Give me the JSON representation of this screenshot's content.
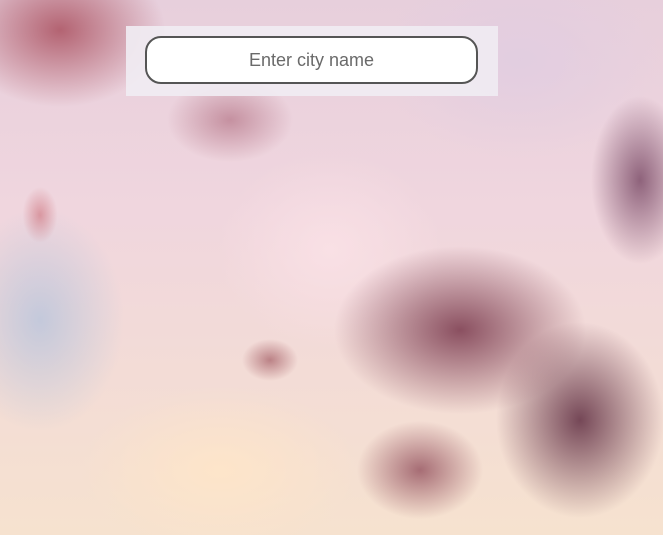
{
  "search": {
    "placeholder": "Enter city name",
    "value": ""
  },
  "background": {
    "description_colors": [
      "#e7cfdc",
      "#7a3a4c",
      "#f6e2cf"
    ]
  }
}
